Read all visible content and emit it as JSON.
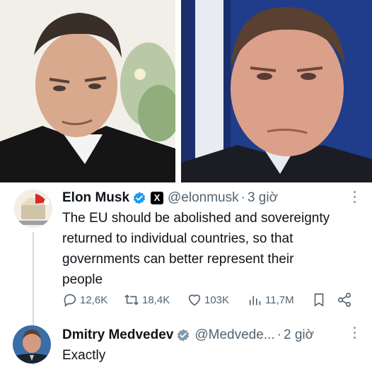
{
  "tweet": {
    "author_name": "Elon Musk",
    "author_handle": "@elonmusk",
    "time": "3 giờ",
    "text_lines": [
      "The EU should be abolished and sovereignty",
      "returned to individual countries, so that",
      "governments can better represent their",
      "people"
    ],
    "metrics": {
      "replies": "12,6K",
      "retweets": "18,4K",
      "likes": "103K",
      "views": "11,7M"
    }
  },
  "reply": {
    "author_name": "Dmitry Medvedev",
    "author_handle": "@Medvede...",
    "time": "2 giờ",
    "text": "Exactly"
  },
  "colors": {
    "verified_blue": "#1d9bf0",
    "verified_gray": "#829aab",
    "secondary_text": "#536471",
    "thread_line": "#cfd9de"
  },
  "icons": [
    "verified-badge-icon",
    "x-logo-icon",
    "more-options-icon",
    "reply-icon",
    "retweet-icon",
    "like-icon",
    "views-icon",
    "bookmark-icon",
    "share-icon"
  ]
}
